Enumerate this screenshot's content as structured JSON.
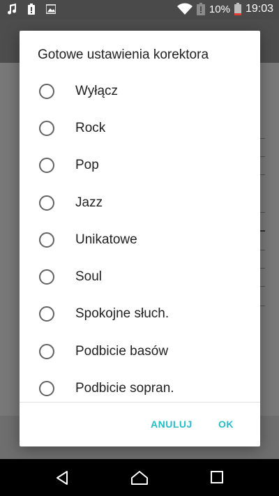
{
  "status_bar": {
    "left_icons": [
      "music-note-icon",
      "battery-alert-icon",
      "image-icon"
    ],
    "battery_percent": "10%",
    "time": "19:03"
  },
  "dialog": {
    "title": "Gotowe ustawienia korektora",
    "options": [
      {
        "label": "Wyłącz",
        "selected": false
      },
      {
        "label": "Rock",
        "selected": false
      },
      {
        "label": "Pop",
        "selected": false
      },
      {
        "label": "Jazz",
        "selected": false
      },
      {
        "label": "Unikatowe",
        "selected": false
      },
      {
        "label": "Soul",
        "selected": false
      },
      {
        "label": "Spokojne słuch.",
        "selected": false
      },
      {
        "label": "Podbicie basów",
        "selected": false
      },
      {
        "label": "Podbicie sopran.",
        "selected": false
      }
    ],
    "cancel_label": "ANULUJ",
    "ok_label": "OK",
    "accent_color": "#26bcc6"
  },
  "nav_bar": {
    "icons": [
      "back-icon",
      "home-icon",
      "recents-icon"
    ]
  }
}
